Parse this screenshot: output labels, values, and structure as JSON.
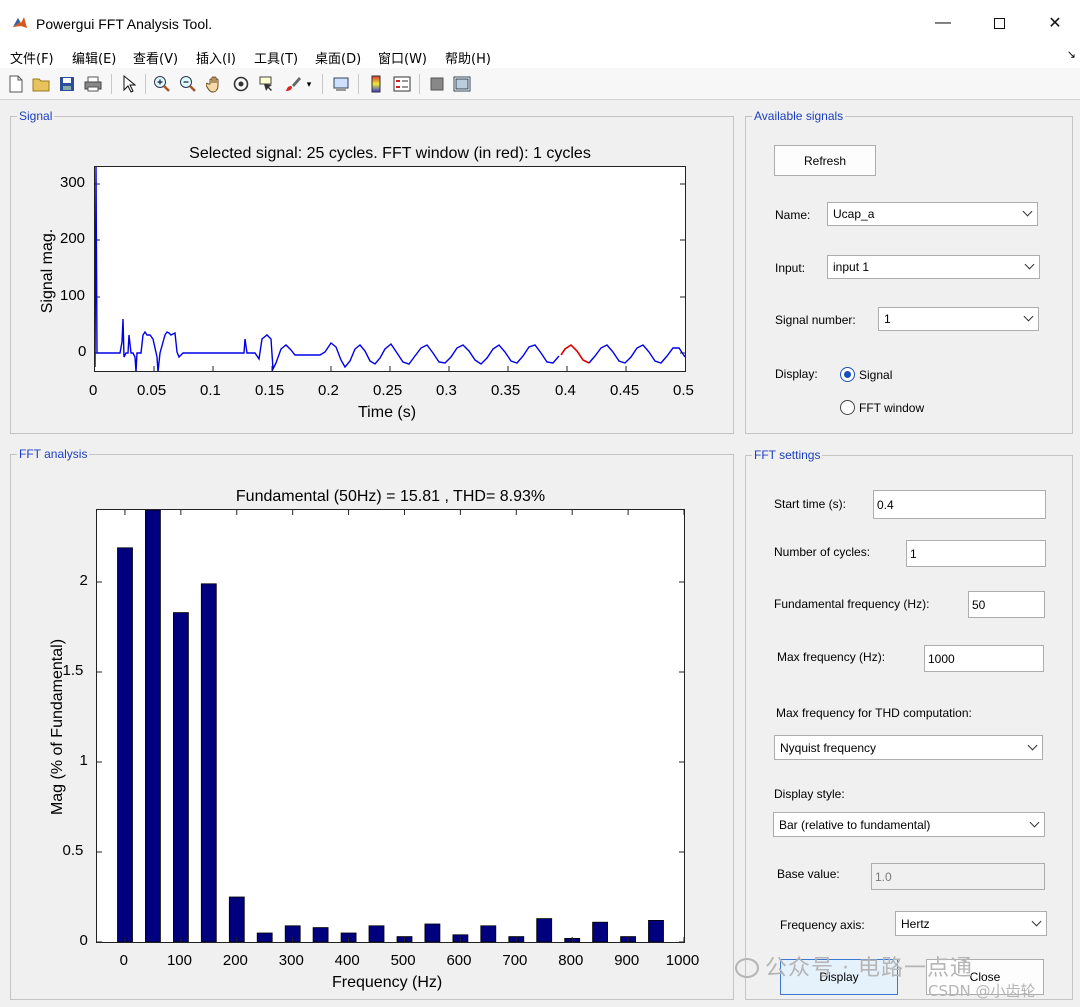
{
  "window": {
    "title": "Powergui FFT Analysis Tool."
  },
  "menu": [
    "文件(F)",
    "编辑(E)",
    "查看(V)",
    "插入(I)",
    "工具(T)",
    "桌面(D)",
    "窗口(W)",
    "帮助(H)"
  ],
  "toolbar": [
    "new-file-icon",
    "open-folder-icon",
    "save-icon",
    "print-icon",
    "pointer-icon",
    "zoom-in-icon",
    "zoom-out-icon",
    "pan-hand-icon",
    "rotate-3d-icon",
    "data-cursor-icon",
    "brush-icon",
    "link-plot-icon",
    "colorbar-icon",
    "legend-icon",
    "hide-plot-tools-icon",
    "show-plot-tools-icon"
  ],
  "signal_panel": {
    "title": "Signal",
    "plot_title": "Selected signal: 25 cycles. FFT window (in red): 1 cycles",
    "xlabel": "Time (s)",
    "ylabel": "Signal mag.",
    "xticks": [
      "0",
      "0.05",
      "0.1",
      "0.15",
      "0.2",
      "0.25",
      "0.3",
      "0.35",
      "0.4",
      "0.45",
      "0.5"
    ],
    "yticks": [
      "300",
      "200",
      "100",
      "0"
    ]
  },
  "available_signals": {
    "title": "Available signals",
    "refresh_label": "Refresh",
    "name_label": "Name:",
    "name_value": "Ucap_a",
    "input_label": "Input:",
    "input_value": "input 1",
    "signal_number_label": "Signal number:",
    "signal_number_value": "1",
    "display_label": "Display:",
    "display_signal": "Signal",
    "display_fft": "FFT window"
  },
  "fft_panel": {
    "title": "FFT analysis"
  },
  "fft_settings": {
    "title": "FFT settings",
    "start_time_label": "Start time (s):",
    "start_time_value": "0.4",
    "cycles_label": "Number of cycles:",
    "cycles_value": "1",
    "fund_freq_label": "Fundamental frequency (Hz):",
    "fund_freq_value": "50",
    "max_freq_label": "Max frequency (Hz):",
    "max_freq_value": "1000",
    "thd_freq_label": "Max frequency for THD computation:",
    "thd_freq_value": "Nyquist frequency",
    "display_style_label": "Display style:",
    "display_style_value": "Bar (relative to fundamental)",
    "base_value_label": "Base value:",
    "base_value_value": "1.0",
    "freq_axis_label": "Frequency axis:",
    "freq_axis_value": "Hertz",
    "display_button": "Display",
    "close_button": "Close"
  },
  "watermark": {
    "wechat": "公众号 · 电路一点通",
    "csdn": "CSDN @小齿轮"
  },
  "chart_data": {
    "type": "bar",
    "title": "Fundamental (50Hz) = 15.81 , THD= 8.93%",
    "xlabel": "Frequency (Hz)",
    "ylabel": "Mag (% of Fundamental)",
    "xlim": [
      -50,
      1000
    ],
    "ylim": [
      0,
      2.4
    ],
    "xticks": [
      0,
      100,
      200,
      300,
      400,
      500,
      600,
      700,
      800,
      900,
      1000
    ],
    "yticks": [
      0,
      0.5,
      1,
      1.5,
      2
    ],
    "x": [
      0,
      50,
      100,
      150,
      200,
      250,
      300,
      350,
      400,
      450,
      500,
      550,
      600,
      650,
      700,
      750,
      800,
      850,
      900,
      950
    ],
    "values": [
      2.19,
      2.4,
      1.83,
      1.99,
      0.25,
      0.05,
      0.09,
      0.08,
      0.05,
      0.09,
      0.03,
      0.1,
      0.04,
      0.09,
      0.03,
      0.13,
      0.02,
      0.11,
      0.03,
      0.12
    ],
    "color": "#00007f",
    "grid": false
  }
}
